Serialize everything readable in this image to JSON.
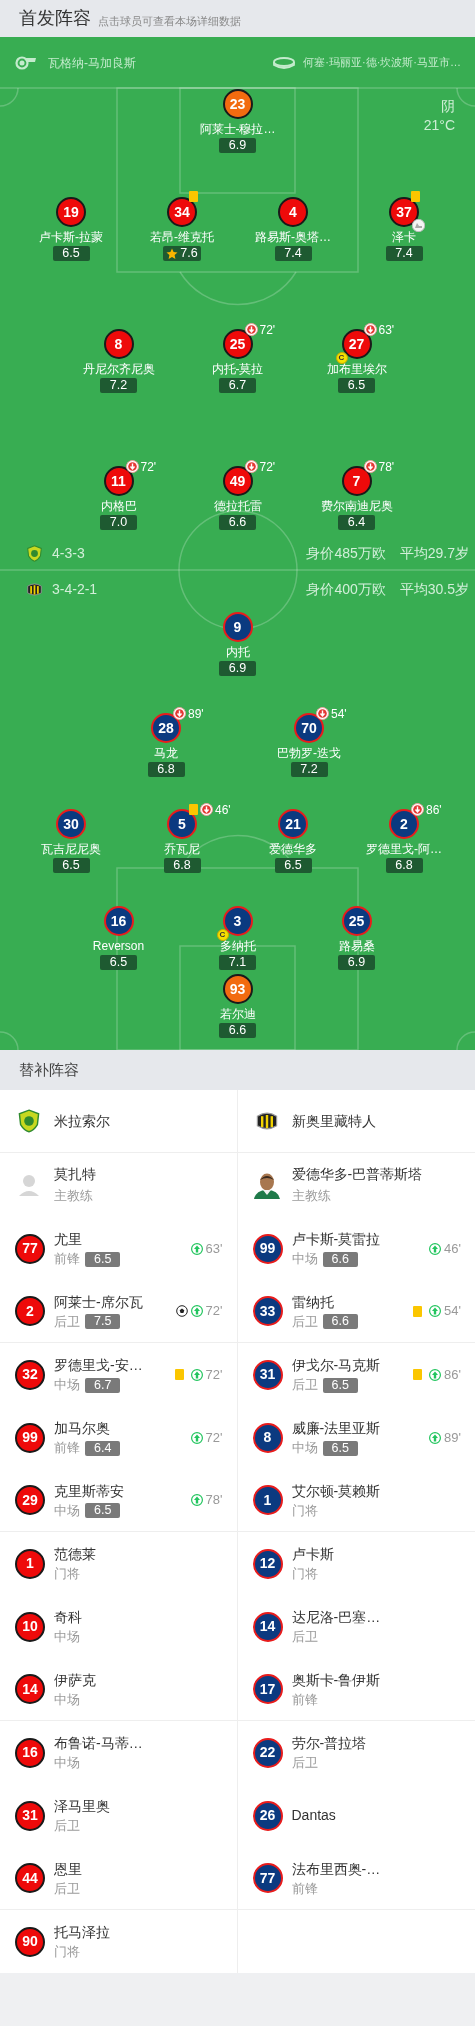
{
  "header": {
    "title": "首发阵容",
    "subtitle": "点击球员可查看本场详细数据"
  },
  "match_info": {
    "referee": "瓦格纳-马加良斯",
    "venue": "何塞·玛丽亚·德·坎波斯·马亚市…",
    "weather": "阴",
    "temperature": "21°C"
  },
  "home": {
    "formation": "4-3-3",
    "value": "身价485万欧",
    "avg_age": "平均29.7岁",
    "lines": [
      [
        {
          "number": "23",
          "name": "阿莱士-穆拉…",
          "rating": "6.9",
          "kind": "goalkeeper"
        }
      ],
      [
        {
          "number": "19",
          "name": "卢卡斯-拉蒙",
          "rating": "6.5",
          "kind": "outfield"
        },
        {
          "number": "34",
          "name": "若昂-维克托",
          "rating": "7.6",
          "kind": "outfield",
          "yellow_card": true,
          "best": true
        },
        {
          "number": "4",
          "name": "路易斯-奥塔…",
          "rating": "7.4",
          "kind": "outfield"
        },
        {
          "number": "37",
          "name": "泽卡",
          "rating": "7.4",
          "kind": "outfield",
          "yellow_card": true,
          "assist": true
        }
      ],
      [
        {
          "number": "8",
          "name": "丹尼尔齐尼奥",
          "rating": "7.2",
          "kind": "outfield"
        },
        {
          "number": "25",
          "name": "内托-莫拉",
          "rating": "6.7",
          "kind": "outfield",
          "sub_off": "72'"
        },
        {
          "number": "27",
          "name": "加布里埃尔",
          "rating": "6.5",
          "kind": "outfield",
          "sub_off": "63'",
          "captain": "C"
        }
      ],
      [
        {
          "number": "11",
          "name": "内格巴",
          "rating": "7.0",
          "kind": "outfield",
          "sub_off": "72'"
        },
        {
          "number": "49",
          "name": "德拉托雷",
          "rating": "6.6",
          "kind": "outfield",
          "sub_off": "72'"
        },
        {
          "number": "7",
          "name": "费尔南迪尼奥",
          "rating": "6.4",
          "kind": "outfield",
          "sub_off": "78'"
        }
      ]
    ]
  },
  "away": {
    "formation": "3-4-2-1",
    "value": "身价400万欧",
    "avg_age": "平均30.5岁",
    "lines": [
      [
        {
          "number": "9",
          "name": "内托",
          "rating": "6.9",
          "kind": "outfield"
        }
      ],
      [
        {
          "number": "28",
          "name": "马龙",
          "rating": "6.8",
          "kind": "outfield",
          "sub_off": "89'"
        },
        {
          "number": "70",
          "name": "巴勃罗-迭戈",
          "rating": "7.2",
          "kind": "outfield",
          "sub_off": "54'"
        }
      ],
      [
        {
          "number": "30",
          "name": "瓦吉尼尼奥",
          "rating": "6.5",
          "kind": "outfield"
        },
        {
          "number": "5",
          "name": "乔瓦尼",
          "rating": "6.8",
          "kind": "outfield",
          "yellow_card": true,
          "sub_off": "46'"
        },
        {
          "number": "21",
          "name": "爱德华多",
          "rating": "6.5",
          "kind": "outfield"
        },
        {
          "number": "2",
          "name": "罗德里戈-阿…",
          "rating": "6.8",
          "kind": "outfield",
          "sub_off": "86'"
        }
      ],
      [
        {
          "number": "16",
          "name": "Reverson",
          "rating": "6.5",
          "kind": "outfield"
        },
        {
          "number": "3",
          "name": "多纳托",
          "rating": "7.1",
          "kind": "outfield",
          "captain": "C"
        },
        {
          "number": "25",
          "name": "路易桑",
          "rating": "6.9",
          "kind": "outfield"
        }
      ],
      [
        {
          "number": "93",
          "name": "若尔迪",
          "rating": "6.6",
          "kind": "goalkeeper"
        }
      ]
    ]
  },
  "bench": {
    "title": "替补阵容",
    "teams": [
      {
        "name": "米拉索尔",
        "coach": "莫扎特",
        "coach_role": "主教练",
        "subs": [
          {
            "number": "77",
            "name": "尤里",
            "position": "前锋",
            "rating": "6.5",
            "sub_on": "63'"
          },
          {
            "number": "2",
            "name": "阿莱士-席尔瓦",
            "position": "后卫",
            "rating": "7.5",
            "goal": true,
            "sub_on": "72'"
          },
          {
            "number": "32",
            "name": "罗德里戈-安…",
            "position": "中场",
            "rating": "6.7",
            "yellow_card": true,
            "sub_on": "72'"
          },
          {
            "number": "99",
            "name": "加马尔奥",
            "position": "前锋",
            "rating": "6.4",
            "sub_on": "72'"
          },
          {
            "number": "29",
            "name": "克里斯蒂安",
            "position": "中场",
            "rating": "6.5",
            "sub_on": "78'"
          },
          {
            "number": "1",
            "name": "范德莱",
            "position": "门将"
          },
          {
            "number": "10",
            "name": "奇科",
            "position": "中场"
          },
          {
            "number": "14",
            "name": "伊萨克",
            "position": "中场"
          },
          {
            "number": "16",
            "name": "布鲁诺-马蒂…",
            "position": "中场"
          },
          {
            "number": "31",
            "name": "泽马里奥",
            "position": "后卫"
          },
          {
            "number": "44",
            "name": "恩里",
            "position": "后卫"
          },
          {
            "number": "90",
            "name": "托马泽拉",
            "position": "门将"
          }
        ]
      },
      {
        "name": "新奥里藏特人",
        "coach": "爱德华多-巴普蒂斯塔",
        "coach_role": "主教练",
        "subs": [
          {
            "number": "99",
            "name": "卢卡斯-莫雷拉",
            "position": "中场",
            "rating": "6.6",
            "sub_on": "46'"
          },
          {
            "number": "33",
            "name": "雷纳托",
            "position": "后卫",
            "rating": "6.6",
            "yellow_card": true,
            "sub_on": "54'"
          },
          {
            "number": "31",
            "name": "伊戈尔-马克斯",
            "position": "后卫",
            "rating": "6.5",
            "yellow_card": true,
            "sub_on": "86'"
          },
          {
            "number": "8",
            "name": "威廉-法里亚斯",
            "position": "中场",
            "rating": "6.5",
            "sub_on": "89'"
          },
          {
            "number": "1",
            "name": "艾尔顿-莫赖斯",
            "position": "门将"
          },
          {
            "number": "12",
            "name": "卢卡斯",
            "position": "门将"
          },
          {
            "number": "14",
            "name": "达尼洛-巴塞…",
            "position": "后卫"
          },
          {
            "number": "17",
            "name": "奥斯卡-鲁伊斯",
            "position": "前锋"
          },
          {
            "number": "22",
            "name": "劳尔-普拉塔",
            "position": "后卫"
          },
          {
            "number": "26",
            "name": "Dantas"
          },
          {
            "number": "77",
            "name": "法布里西奥-…",
            "position": "前锋"
          }
        ]
      }
    ]
  }
}
